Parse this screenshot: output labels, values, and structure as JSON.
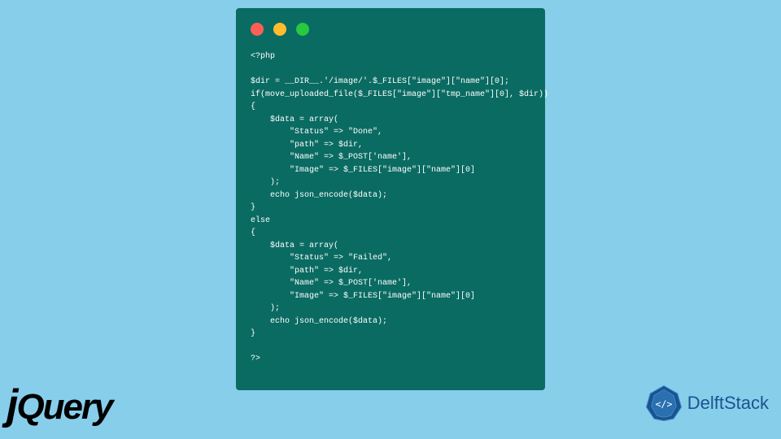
{
  "code": {
    "line1": "<?php",
    "line2": "",
    "line3": "$dir = __DIR__.'/image/'.$_FILES[\"image\"][\"name\"][0];",
    "line4": "if(move_uploaded_file($_FILES[\"image\"][\"tmp_name\"][0], $dir))",
    "line5": "{",
    "line6": "    $data = array(",
    "line7": "        \"Status\" => \"Done\",",
    "line8": "        \"path\" => $dir,",
    "line9": "        \"Name\" => $_POST['name'],",
    "line10": "        \"Image\" => $_FILES[\"image\"][\"name\"][0]",
    "line11": "    );",
    "line12": "    echo json_encode($data);",
    "line13": "}",
    "line14": "else",
    "line15": "{",
    "line16": "    $data = array(",
    "line17": "        \"Status\" => \"Failed\",",
    "line18": "        \"path\" => $dir,",
    "line19": "        \"Name\" => $_POST['name'],",
    "line20": "        \"Image\" => $_FILES[\"image\"][\"name\"][0]",
    "line21": "    );",
    "line22": "    echo json_encode($data);",
    "line23": "}",
    "line24": "",
    "line25": "?>"
  },
  "logos": {
    "jquery": "jQuery",
    "delftstack": "DelftStack"
  }
}
